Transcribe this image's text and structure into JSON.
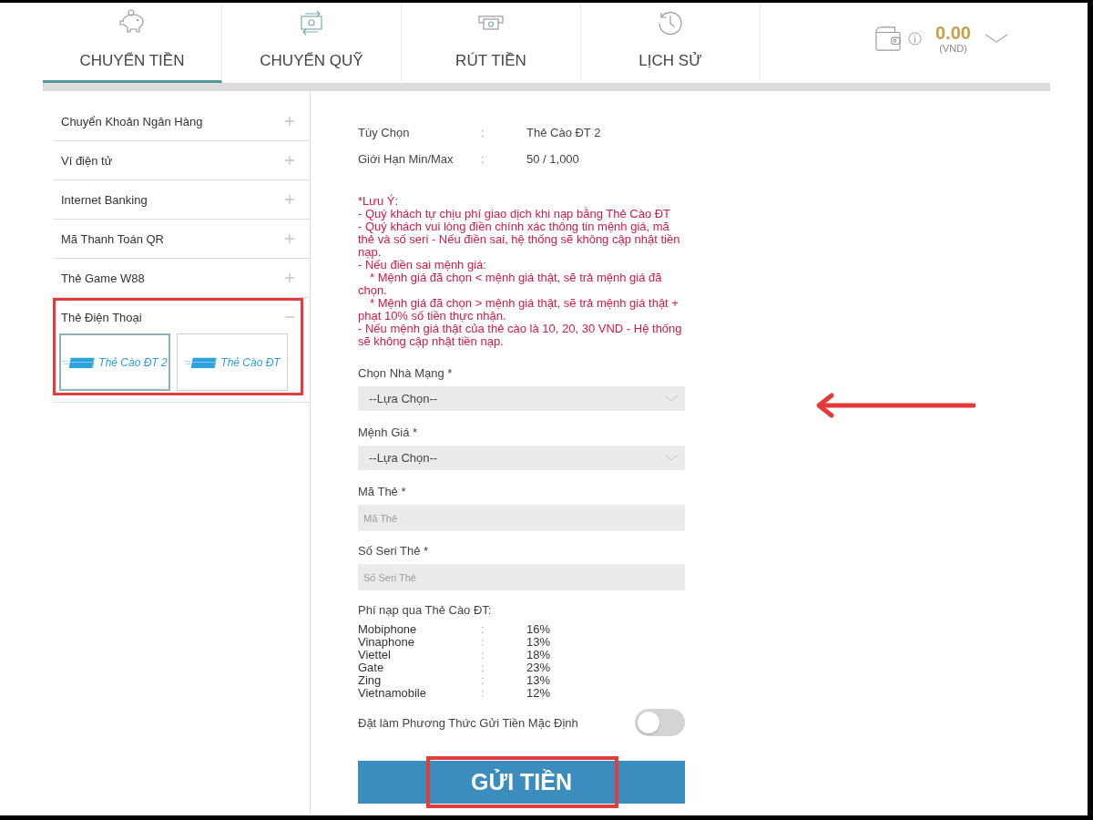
{
  "tabs": [
    {
      "label": "CHUYỂN TIỀN",
      "selected": true
    },
    {
      "label": "CHUYỂN QUỸ",
      "selected": false
    },
    {
      "label": "RÚT TIỀN",
      "selected": false
    },
    {
      "label": "LỊCH SỬ",
      "selected": false
    }
  ],
  "wallet": {
    "balance": "0.00",
    "currency": "(VND)"
  },
  "sidebar": {
    "items": [
      {
        "label": "Chuyển Khoản Ngân Hàng",
        "expanded": false,
        "highlighted": false
      },
      {
        "label": "Ví điện tử",
        "expanded": false,
        "highlighted": false
      },
      {
        "label": "Internet Banking",
        "expanded": false,
        "highlighted": false
      },
      {
        "label": "Mã Thanh Toán QR",
        "expanded": false,
        "highlighted": false
      },
      {
        "label": "Thẻ Game W88",
        "expanded": false,
        "highlighted": false
      },
      {
        "label": "Thẻ Điện Thoại",
        "expanded": true,
        "highlighted": true,
        "options": [
          {
            "label": "Thẻ Cào ĐT 2",
            "selected": true
          },
          {
            "label": "Thẻ Cào ĐT",
            "selected": false
          }
        ]
      }
    ]
  },
  "details": [
    {
      "label": "Tùy Chọn",
      "separator": ":",
      "value": "Thẻ Cào ĐT 2"
    },
    {
      "label": "Giới Hạn Min/Max",
      "separator": ":",
      "value": "50 / 1,000"
    }
  ],
  "notes": {
    "title": "*Lưu Ý:",
    "items": [
      {
        "kind": "bullet",
        "text": "- Quý khách tự chịu phí giao dịch khi nạp bằng Thẻ Cào ĐT"
      },
      {
        "kind": "bullet",
        "text": "- Quý khách vui lòng điền chính xác thông tin mệnh giá, mã thẻ và số seri - Nếu điền sai, hệ thống sẽ không cập nhật tiền nạp."
      },
      {
        "kind": "bullet",
        "text": "- Nếu điền sai mệnh giá:"
      },
      {
        "kind": "sub",
        "text": "* Mệnh giá đã chọn < mệnh giá thật, sẽ trả mệnh giá đã chọn."
      },
      {
        "kind": "sub",
        "text": "* Mệnh giá đã chọn > mệnh giá thật, sẽ trả mệnh giá thật + phạt 10% số tiền thực nhận."
      },
      {
        "kind": "bullet",
        "text": "- Nếu mệnh giá thật của thẻ cào là 10, 20, 30 VND - Hệ thống sẽ không cập nhật tiền nạp."
      }
    ]
  },
  "fields": [
    {
      "kind": "select",
      "label": "Chọn Nhà Mạng *",
      "value": "--Lựa Chọn--"
    },
    {
      "kind": "select",
      "label": "Mệnh Giá *",
      "value": "--Lựa Chọn--"
    },
    {
      "kind": "input",
      "label": "Mã Thẻ *",
      "placeholder": "Mã Thẻ"
    },
    {
      "kind": "input",
      "label": "Số Seri Thẻ *",
      "placeholder": "Số Seri Thẻ"
    }
  ],
  "fees": {
    "title": "Phí nạp qua Thẻ Cào ĐT:",
    "rows": [
      {
        "carrier": "Mobiphone",
        "separator": ":",
        "rate": "16%"
      },
      {
        "carrier": "Vinaphone",
        "separator": ":",
        "rate": "13%"
      },
      {
        "carrier": "Viettel",
        "separator": ":",
        "rate": "18%"
      },
      {
        "carrier": "Gate",
        "separator": ":",
        "rate": "23%"
      },
      {
        "carrier": "Zing",
        "separator": ":",
        "rate": "13%"
      },
      {
        "carrier": "Vietnamobile",
        "separator": ":",
        "rate": "12%"
      }
    ]
  },
  "default_toggle": {
    "label": "Đặt làm Phương Thức Gửi Tiền Mặc Định",
    "on": false
  },
  "submit": {
    "label": "GỬI TIỀN",
    "highlighted": true
  }
}
